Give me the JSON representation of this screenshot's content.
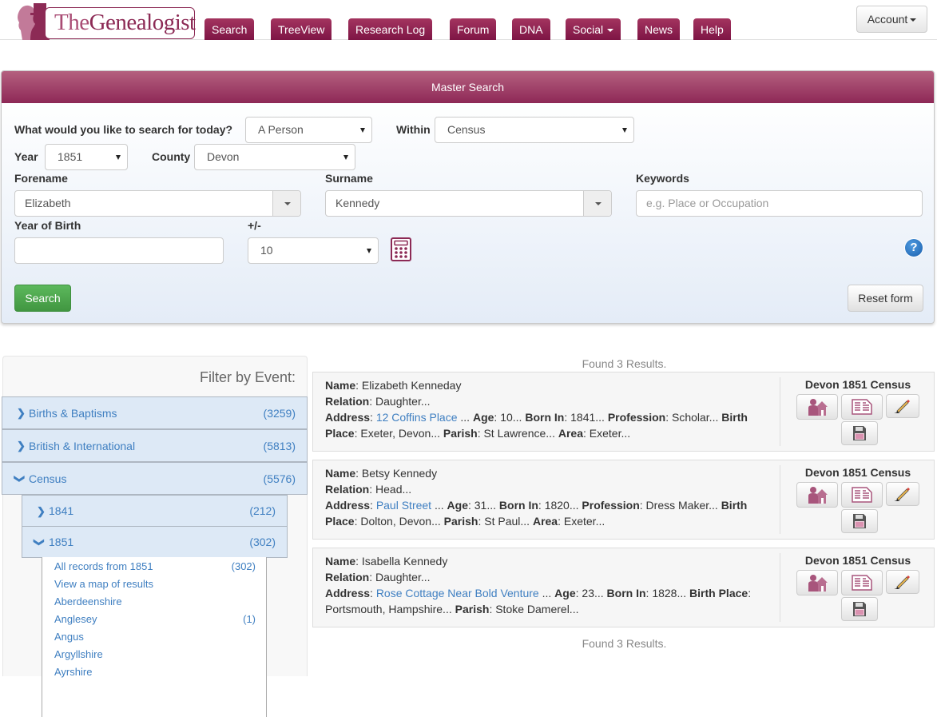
{
  "header": {
    "logo": {
      "prefix": "The",
      "name": "Genealogist"
    },
    "nav": [
      {
        "label": "Search",
        "dropdown": false
      },
      {
        "label": "TreeView",
        "dropdown": false
      },
      {
        "label": "Research Log",
        "dropdown": false
      },
      {
        "label": "Forum",
        "dropdown": false
      },
      {
        "label": "DNA",
        "dropdown": false
      },
      {
        "label": "Social",
        "dropdown": true
      },
      {
        "label": "News",
        "dropdown": false
      },
      {
        "label": "Help",
        "dropdown": false
      }
    ],
    "account_label": "Account"
  },
  "master_search": {
    "title": "Master Search",
    "search_for_label": "What would you like to search for today?",
    "search_for_value": "A Person",
    "within_label": "Within",
    "within_value": "Census",
    "year_label": "Year",
    "year_value": "1851",
    "county_label": "County",
    "county_value": "Devon",
    "forename_label": "Forename",
    "forename_value": "Elizabeth",
    "surname_label": "Surname",
    "surname_value": "Kennedy",
    "keywords_label": "Keywords",
    "keywords_placeholder": "e.g. Place or Occupation",
    "keywords_value": "",
    "yob_label": "Year of Birth",
    "yob_value": "",
    "plusminus_label": "+/-",
    "plusminus_value": "10",
    "search_button": "Search",
    "reset_button": "Reset form",
    "help_glyph": "?"
  },
  "filter": {
    "title": "Filter by Event:",
    "events": [
      {
        "label": "Births & Baptisms",
        "count": "(3259)",
        "expanded": false
      },
      {
        "label": "British & International",
        "count": "(5813)",
        "expanded": false
      },
      {
        "label": "Census",
        "count": "(5576)",
        "expanded": true
      }
    ],
    "years": [
      {
        "label": "1841",
        "count": "(212)",
        "expanded": false
      },
      {
        "label": "1851",
        "count": "(302)",
        "expanded": true
      }
    ],
    "sub_items": [
      {
        "label": "All records from 1851",
        "count": "(302)"
      },
      {
        "label": "View a map of results",
        "count": ""
      },
      {
        "label": "Aberdeenshire",
        "count": ""
      },
      {
        "label": "Anglesey",
        "count": "(1)"
      },
      {
        "label": "Angus",
        "count": ""
      },
      {
        "label": "Argyllshire",
        "count": ""
      },
      {
        "label": "Ayrshire",
        "count": ""
      }
    ]
  },
  "results": {
    "found_text": "Found 3 Results.",
    "field_labels": {
      "name": "Name",
      "relation": "Relation",
      "address": "Address",
      "age": "Age",
      "born_in": "Born In",
      "profession": "Profession",
      "birth_place": "Birth Place",
      "parish": "Parish",
      "area": "Area"
    },
    "items": [
      {
        "name": "Elizabeth Kenneday",
        "relation": "Daughter...",
        "address": "12 Coffins Place",
        "age": "10...",
        "born_in": "1841...",
        "profession": "Scholar...",
        "birth_place": "Exeter, Devon...",
        "parish": "St Lawrence...",
        "area": "Exeter...",
        "source": "Devon 1851 Census"
      },
      {
        "name": "Betsy Kennedy",
        "relation": "Head...",
        "address": "Paul Street",
        "age": "31...",
        "born_in": "1820...",
        "profession": "Dress Maker...",
        "birth_place": "Dolton, Devon...",
        "parish": "St Paul...",
        "area": "Exeter...",
        "source": "Devon 1851 Census"
      },
      {
        "name": "Isabella Kennedy",
        "relation": "Daughter...",
        "address": "Rose Cottage Near Bold Venture",
        "age": "23...",
        "born_in": "1828...",
        "birth_place": "Portsmouth, Hampshire...",
        "parish": "Stoke Damerel...",
        "source": "Devon 1851 Census"
      }
    ],
    "action_icons": [
      "household-icon",
      "transcript-icon",
      "edit-icon",
      "save-icon"
    ]
  },
  "colors": {
    "brand": "#8c2a55",
    "nav_button": "#8e2050",
    "link": "#3f7fc1",
    "search_button": "#4cae4c",
    "filter_row_bg": "#dde9f6"
  }
}
